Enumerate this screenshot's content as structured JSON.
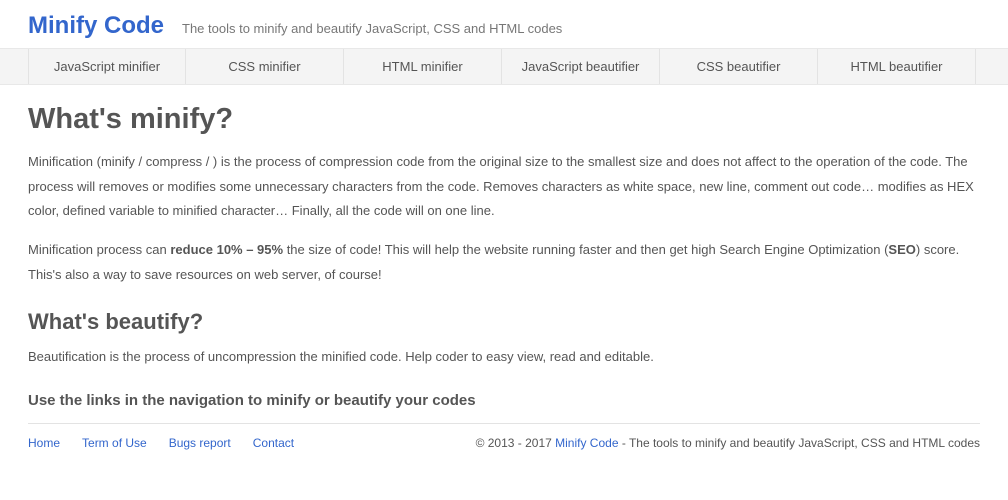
{
  "header": {
    "title": "Minify Code",
    "tagline": "The tools to minify and beautify JavaScript, CSS and HTML codes"
  },
  "nav": {
    "items": [
      {
        "label": "JavaScript minifier"
      },
      {
        "label": "CSS minifier"
      },
      {
        "label": "HTML minifier"
      },
      {
        "label": "JavaScript beautifier"
      },
      {
        "label": "CSS beautifier"
      },
      {
        "label": "HTML beautifier"
      }
    ]
  },
  "main": {
    "h1": "What's minify?",
    "p1": "Minification (minify / compress / ) is the process of compression code from the original size to the smallest size and does not affect to the operation of the code. The process will removes or modifies some unnecessary characters from the code. Removes characters as white space, new line, comment out code… modifies as HEX color, defined variable to minified character… Finally, all the code will on one line.",
    "p2_prefix": "Minification process can ",
    "p2_strong1": "reduce 10% – 95%",
    "p2_mid": " the size of code! This will help the website running faster and then get high Search Engine Optimization (",
    "p2_strong2": "SEO",
    "p2_suffix": ") score. This's also a way to save resources on web server, of course!",
    "h2": "What's beautify?",
    "p3": "Beautification is the process of uncompression the minified code. Help coder to easy view, read and editable.",
    "h3": "Use the links in the navigation to minify or beautify your codes"
  },
  "footer": {
    "links": [
      {
        "label": "Home"
      },
      {
        "label": "Term of Use"
      },
      {
        "label": "Bugs report"
      },
      {
        "label": "Contact"
      }
    ],
    "copyright_prefix": "© 2013 - 2017 ",
    "brand": "Minify Code",
    "copyright_suffix": " - The tools to minify and beautify JavaScript, CSS and HTML codes"
  }
}
